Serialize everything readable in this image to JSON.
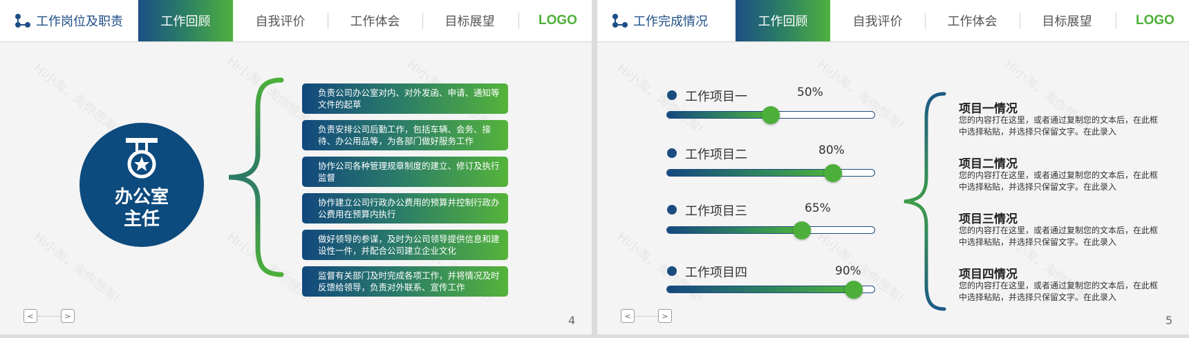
{
  "slide1": {
    "header": {
      "title": "工作岗位及职责",
      "tabs": [
        "工作回顾",
        "自我评价",
        "工作体会",
        "目标展望"
      ],
      "active_tab": 0,
      "logo": "LOGO"
    },
    "badge": {
      "icon": "medal-icon",
      "label_line1": "办公室",
      "label_line2": "主任"
    },
    "duties": [
      "负责公司办公室对内、对外发函、申请、通知等文件的起草",
      "负责安排公司后勤工作，包括车辆、会务、接待、办公用品等，为各部门做好服务工作",
      "协作公司各种管理规章制度的建立、修订及执行监督",
      "协作建立公司行政办公费用的预算并控制行政办公费用在预算内执行",
      "做好领导的参谋，及时为公司领导提供信息和建设性一件，并配合公司建立企业文化",
      "监督有关部门及时完成各项工作，并将情况及时反馈给领导，负责对外联系、宣传工作"
    ],
    "page_number": "4"
  },
  "slide2": {
    "header": {
      "title": "工作完成情况",
      "tabs": [
        "工作回顾",
        "自我评价",
        "工作体会",
        "目标展望"
      ],
      "active_tab": 0,
      "logo": "LOGO"
    },
    "projects": [
      {
        "name": "工作项目一",
        "percent_label": "50%",
        "progress": 0.5
      },
      {
        "name": "工作项目二",
        "percent_label": "80%",
        "progress": 0.8
      },
      {
        "name": "工作项目三",
        "percent_label": "65%",
        "progress": 0.65
      },
      {
        "name": "工作项目四",
        "percent_label": "90%",
        "progress": 0.9
      }
    ],
    "details": [
      {
        "title": "项目一情况",
        "desc": "您的内容打在这里，或者通过复制您的文本后，在此框中选择粘贴，并选择只保留文字。在此录入"
      },
      {
        "title": "项目二情况",
        "desc": "您的内容打在这里，或者通过复制您的文本后，在此框中选择粘贴，并选择只保留文字。在此录入"
      },
      {
        "title": "项目三情况",
        "desc": "您的内容打在这里，或者通过复制您的文本后，在此框中选择粘贴，并选择只保留文字。在此录入"
      },
      {
        "title": "项目四情况",
        "desc": "您的内容打在这里，或者通过复制您的文本后，在此框中选择粘贴，并选择只保留文字。在此录入"
      }
    ],
    "page_number": "5"
  },
  "watermark_text": "Hi小淘，淘你想淘!",
  "pager": {
    "prev_icon": "chevron-left-icon",
    "next_icon": "chevron-right-icon",
    "prev": "<",
    "next": ">"
  },
  "colors": {
    "brand_blue": "#0d4a7d",
    "brand_green": "#4caf36"
  }
}
